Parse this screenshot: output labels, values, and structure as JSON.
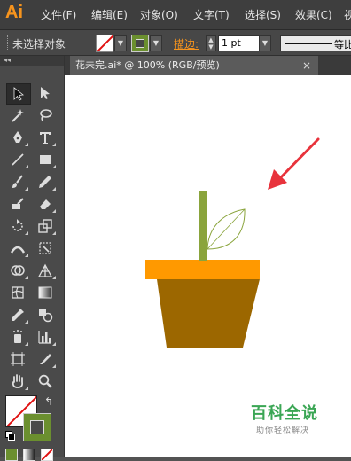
{
  "app": {
    "logo": "Ai"
  },
  "menu": {
    "items": [
      "文件(F)",
      "编辑(E)",
      "对象(O)",
      "文字(T)",
      "选择(S)",
      "效果(C)",
      "视"
    ]
  },
  "control_bar": {
    "selection_label": "未选择对象",
    "stroke_label": "描边:",
    "stroke_weight": "1 pt",
    "line_style": "等比"
  },
  "document": {
    "tab_title": "花未完.ai* @ 100% (RGB/预览)",
    "close": "×"
  },
  "tools": {
    "panel_collapse": "◂◂"
  },
  "colors": {
    "accent": "#f7941d",
    "pot_rim": "#ff9900",
    "pot_body": "#9c6700",
    "stem": "#8aa43c",
    "arrow": "#e8333c",
    "stroke_swatch": "#6b8f2f"
  },
  "watermark": {
    "title": "百科全说",
    "subtitle": "助你轻松解决"
  }
}
